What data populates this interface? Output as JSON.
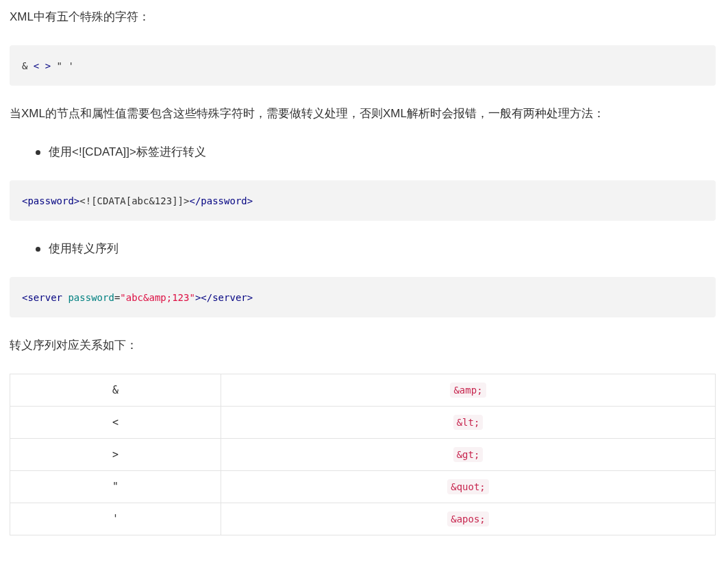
{
  "blocks": [
    {
      "kind": "paragraph",
      "text": "XML中有五个特殊的字符："
    },
    {
      "kind": "code",
      "tokens": [
        {
          "kind": "plain",
          "text": "& "
        },
        {
          "kind": "tag",
          "text": "< >"
        },
        {
          "kind": "plain",
          "text": " \" '"
        }
      ]
    },
    {
      "kind": "paragraph",
      "text": "当XML的节点和属性值需要包含这些特殊字符时，需要做转义处理，否则XML解析时会报错，一般有两种处理方法："
    },
    {
      "kind": "bullet",
      "text": "使用<![CDATA]]>标签进行转义"
    },
    {
      "kind": "code",
      "tokens": [
        {
          "kind": "tag",
          "text": "<password>"
        },
        {
          "kind": "plain",
          "text": "<![CDATA[abc&123]]>"
        },
        {
          "kind": "tag",
          "text": "</password>"
        }
      ]
    },
    {
      "kind": "bullet",
      "text": "使用转义序列"
    },
    {
      "kind": "code",
      "tokens": [
        {
          "kind": "tag",
          "text": "<server "
        },
        {
          "kind": "attr",
          "text": "password"
        },
        {
          "kind": "plain",
          "text": "="
        },
        {
          "kind": "string",
          "text": "\"abc&amp;123\""
        },
        {
          "kind": "tag",
          "text": "></server>"
        }
      ]
    },
    {
      "kind": "paragraph",
      "text": "转义序列对应关系如下："
    }
  ],
  "table": {
    "rows": [
      {
        "column_1": "&",
        "column_2": "&amp;"
      },
      {
        "column_1": "<",
        "column_2": "&lt;"
      },
      {
        "column_1": ">",
        "column_2": "&gt;"
      },
      {
        "column_1": "\"",
        "column_2": "&quot;"
      },
      {
        "column_1": "'",
        "column_2": "&apos;"
      }
    ]
  }
}
